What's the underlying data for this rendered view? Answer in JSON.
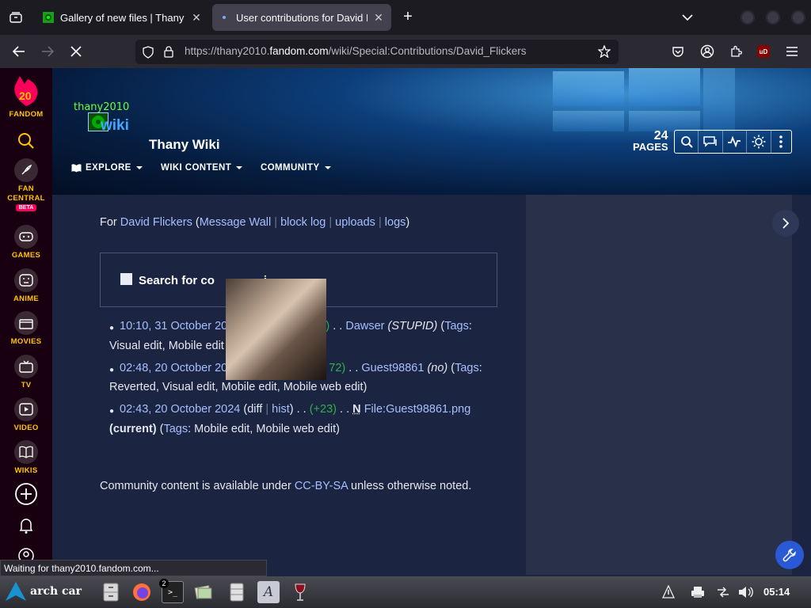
{
  "browser": {
    "tabs": [
      {
        "label": "Gallery of new files | Thany Wiki",
        "active": false
      },
      {
        "label": "User contributions for David Flickers",
        "active": true
      }
    ],
    "url": {
      "prefix": "https://thany2010.",
      "domain": "fandom.com",
      "path": "/wiki/Special:Contributions/David_Flickers"
    },
    "status_text": "Waiting for thany2010.fandom.com...",
    "ublock_label": "uD"
  },
  "fandom_sidebar": {
    "logo_number": "20",
    "logo_label": "FANDOM",
    "items": [
      {
        "label": "FAN CENTRAL",
        "badge": "BETA"
      },
      {
        "label": "GAMES"
      },
      {
        "label": "ANIME"
      },
      {
        "label": "MOVIES"
      },
      {
        "label": "TV"
      },
      {
        "label": "VIDEO"
      },
      {
        "label": "WIKIS"
      }
    ]
  },
  "wiki": {
    "logo_text_top": "thany2010",
    "logo_text_bottom": "wiki",
    "name": "Thany Wiki",
    "nav": [
      "EXPLORE",
      "WIKI CONTENT",
      "COMMUNITY"
    ],
    "page_count": "24",
    "page_count_label": "PAGES"
  },
  "contrib": {
    "for_prefix": "For",
    "user": "David Flickers",
    "links": [
      "Message Wall",
      "block log",
      "uploads",
      "logs"
    ],
    "search_title": "Search for contributions",
    "search_title_visible": "Search for co",
    "search_title_tail": "i",
    "entries": [
      {
        "time_visible": "10:10, 31 October 202",
        "diff_tail": ")",
        "sep": " . . ",
        "title": "Dawser",
        "summary": "(STUPID)",
        "tags_label": "Tags",
        "tags_line2": "Visual edit, Mobile edit"
      },
      {
        "time_visible": "02:48, 20 October 20",
        "diff_tail": "72)",
        "sep": " . . ",
        "title": "Guest98861",
        "summary": "(no)",
        "tags_label": "Tags",
        "tags_line2": "Reverted, Visual edit, Mobile edit, Mobile web edit)"
      },
      {
        "time": "02:43, 20 October 2024",
        "diff": "diff",
        "hist": "hist",
        "size": "(+23)",
        "sep": " . . ",
        "new_flag": "N",
        "title": "File:Guest98861.png",
        "current": "(current)",
        "tags_label": "Tags",
        "tags_value": ": Mobile edit, Mobile web edit)"
      }
    ],
    "footer_pre": "Community content is available under",
    "footer_link": "CC-BY-SA",
    "footer_post": "unless otherwise noted."
  },
  "taskbar": {
    "start_label": "arch car",
    "terminal_badge": "2",
    "clock": "05:14"
  }
}
